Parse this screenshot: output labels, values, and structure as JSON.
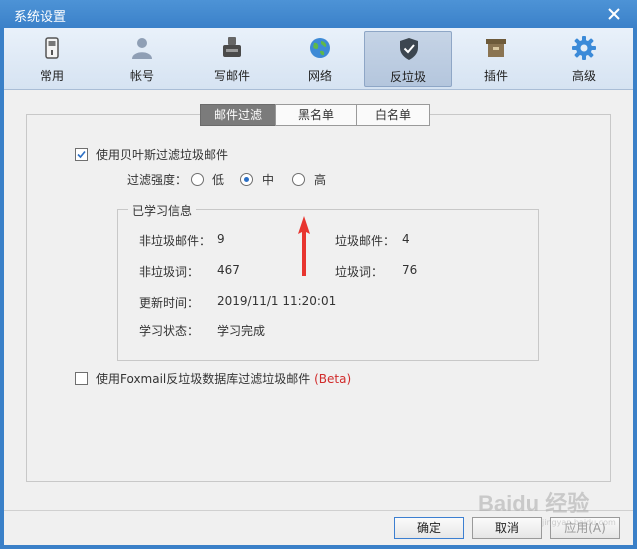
{
  "window": {
    "title": "系统设置"
  },
  "toolbar": {
    "items": [
      {
        "label": "常用",
        "icon": "phone-icon"
      },
      {
        "label": "帐号",
        "icon": "user-icon"
      },
      {
        "label": "写邮件",
        "icon": "compose-icon"
      },
      {
        "label": "网络",
        "icon": "globe-icon"
      },
      {
        "label": "反垃圾",
        "icon": "shield-icon",
        "active": true
      },
      {
        "label": "插件",
        "icon": "box-icon"
      },
      {
        "label": "高级",
        "icon": "gear-icon"
      }
    ]
  },
  "tabs": [
    {
      "label": "邮件过滤",
      "active": true
    },
    {
      "label": "黑名单"
    },
    {
      "label": "白名单"
    }
  ],
  "bayes": {
    "checkbox_label": "使用贝叶斯过滤垃圾邮件",
    "checked": true,
    "strength_label": "过滤强度：",
    "options": [
      {
        "label": "低",
        "selected": false
      },
      {
        "label": "中",
        "selected": true
      },
      {
        "label": "高",
        "selected": false
      }
    ]
  },
  "learned": {
    "group_title": "已学习信息",
    "non_spam_mail_label": "非垃圾邮件：",
    "non_spam_mail_value": "9",
    "spam_mail_label": "垃圾邮件：",
    "spam_mail_value": "4",
    "non_spam_words_label": "非垃圾词：",
    "non_spam_words_value": "467",
    "spam_words_label": "垃圾词：",
    "spam_words_value": "76",
    "update_time_label": "更新时间：",
    "update_time_value": "2019/11/1 11:20:01",
    "status_label": "学习状态：",
    "status_value": "学习完成"
  },
  "foxmail_db": {
    "checkbox_label": "使用Foxmail反垃圾数据库过滤垃圾邮件",
    "beta_label": "(Beta)",
    "checked": false
  },
  "buttons": {
    "ok": "确定",
    "cancel": "取消",
    "apply": "应用(A)"
  },
  "watermark": {
    "main": "Baidu 经验",
    "sub": "jingyan.baidu.com"
  },
  "colors": {
    "title_bar": "#3b81c9",
    "accent": "#2b6fc5",
    "arrow": "#e8352f",
    "beta": "#d12b2b"
  }
}
